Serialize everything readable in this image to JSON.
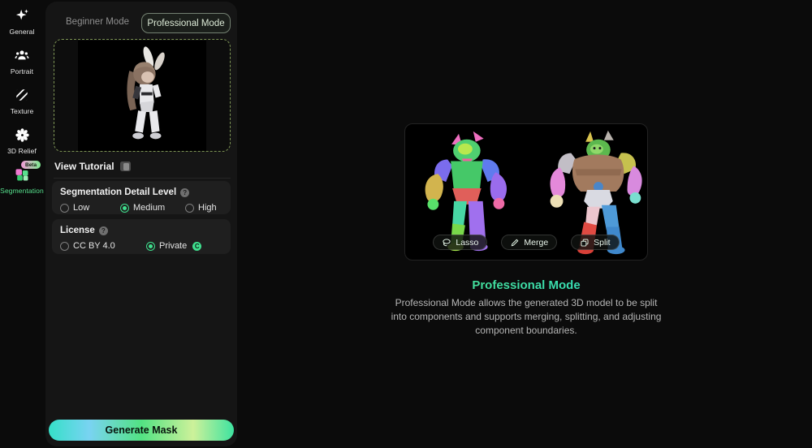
{
  "sidebar": {
    "items": [
      {
        "label": "General",
        "icon": "sparkle-icon"
      },
      {
        "label": "Portrait",
        "icon": "portrait-icon"
      },
      {
        "label": "Texture",
        "icon": "texture-icon"
      },
      {
        "label": "3D Relief",
        "icon": "relief-gear-icon"
      },
      {
        "label": "Segmentation",
        "icon": "segmentation-icon",
        "badge": "Beta",
        "active": true
      }
    ]
  },
  "panel": {
    "tabs": {
      "beginner": "Beginner Mode",
      "professional": "Professional Mode",
      "selected": "Professional Mode"
    },
    "view_tutorial": "View Tutorial",
    "detail": {
      "title": "Segmentation Detail Level",
      "options": [
        "Low",
        "Medium",
        "High"
      ],
      "selected": "Medium"
    },
    "license": {
      "title": "License",
      "options": [
        "CC BY 4.0",
        "Private"
      ],
      "selected": "Private"
    },
    "generate_label": "Generate Mask",
    "help_glyph": "?",
    "private_glyph": "C"
  },
  "main": {
    "tools": [
      {
        "label": "Lasso",
        "icon": "lasso-icon"
      },
      {
        "label": "Merge",
        "icon": "merge-pen-icon"
      },
      {
        "label": "Split",
        "icon": "split-icon"
      }
    ],
    "heading": "Professional Mode",
    "description": "Professional Mode allows the generated 3D model to be split into components and supports merging, splitting, and adjusting component boundaries."
  },
  "colors": {
    "accent_green": "#3fe08e",
    "heading_gradient": [
      "#4be08d",
      "#30ddc2"
    ],
    "generate_gradient": [
      "#35e0c8",
      "#79d3f2",
      "#52e283",
      "#cdf19a",
      "#3ee3a0"
    ],
    "beta_gradient": [
      "#f49ad8",
      "#7ce98f"
    ],
    "panel_bg": "#151515",
    "card_bg": "#1f1f1f",
    "page_bg": "#0b0b0b"
  }
}
